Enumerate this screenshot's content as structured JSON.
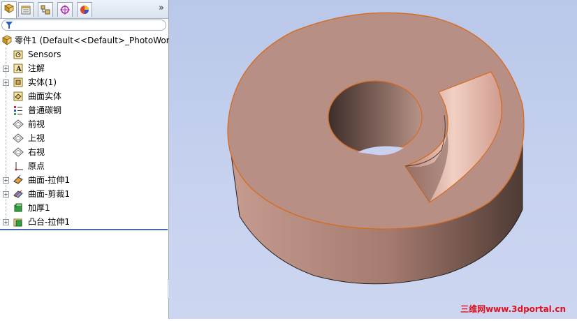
{
  "tabs": [
    "FeatureManager",
    "PropertyManager",
    "ConfigurationManager",
    "DimXpertManager",
    "DisplayManager"
  ],
  "chevron": "»",
  "tree": {
    "root_label": "零件1  (Default<<Default>_PhotoWor",
    "items": [
      {
        "label": "Sensors",
        "icon": "sensor-icon"
      },
      {
        "label": "注解",
        "icon": "annotation-icon"
      },
      {
        "label": "实体(1)",
        "icon": "solid-body-icon"
      },
      {
        "label": "曲面实体",
        "icon": "surface-body-icon"
      },
      {
        "label": "普通碳钢",
        "icon": "material-icon"
      },
      {
        "label": "前视",
        "icon": "plane-icon"
      },
      {
        "label": "上视",
        "icon": "plane-icon"
      },
      {
        "label": "右视",
        "icon": "plane-icon"
      },
      {
        "label": "原点",
        "icon": "origin-icon"
      },
      {
        "label": "曲面-拉伸1",
        "icon": "surface-extrude-icon"
      },
      {
        "label": "曲面-剪裁1",
        "icon": "surface-trim-icon"
      },
      {
        "label": "加厚1",
        "icon": "thicken-icon"
      },
      {
        "label": "凸台-拉伸1",
        "icon": "boss-extrude-icon"
      }
    ]
  },
  "watermark": "三维网www.3dportal.cn",
  "colors": {
    "part": "#b88f84",
    "viewport_bg": "#c3cfee",
    "edge": "#d96a1c",
    "watermark": "#e01020"
  }
}
